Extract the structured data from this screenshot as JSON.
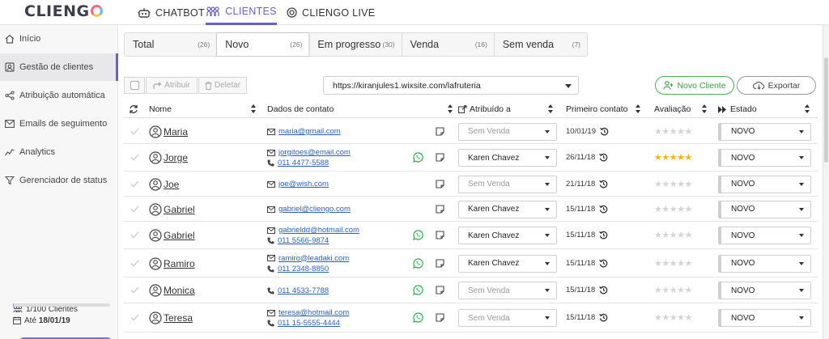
{
  "brand": {
    "logo_text": "CLIENG",
    "accent": "#6c5fc7"
  },
  "top_nav": [
    {
      "label": "CHATBOT",
      "icon": "robot-icon"
    },
    {
      "label": "CLIENTES",
      "icon": "people-icon",
      "active": true
    },
    {
      "label": "CLIENGO LIVE",
      "icon": "live-icon"
    }
  ],
  "sidebar": {
    "items": [
      {
        "label": "Início",
        "icon": "home-icon"
      },
      {
        "label": "Gestão de clientes",
        "icon": "person-card-icon",
        "active": true
      },
      {
        "label": "Atribuição automática",
        "icon": "share-icon"
      },
      {
        "label": "Emails de seguimento",
        "icon": "mail-icon"
      },
      {
        "label": "Analytics",
        "icon": "analytics-icon"
      },
      {
        "label": "Gerenciador de status",
        "icon": "funnel-icon"
      }
    ],
    "clients_usage": "1/100 Clientes",
    "until_label": "Até",
    "until_date": "18/01/19",
    "usage_fraction": 0.01
  },
  "status_tabs": [
    {
      "label": "Total",
      "count": "(26)"
    },
    {
      "label": "Novo",
      "count": "(26)",
      "active": true
    },
    {
      "label": "Em progresso",
      "count": "(30)"
    },
    {
      "label": "Venda",
      "count": "(16)"
    },
    {
      "label": "Sem venda",
      "count": "(7)"
    }
  ],
  "toolbar": {
    "assign_label": "Atribuir",
    "delete_label": "Deletar",
    "site_url": "https://kiranjules1.wixsite.com/lafruteria",
    "new_client_label": "Novo Cliente",
    "export_label": "Exportar"
  },
  "table": {
    "headers": {
      "name": "Nome",
      "contact": "Dados de contato",
      "assigned": "Atribuído a",
      "first_contact": "Primeiro contato",
      "rating": "Avaliação",
      "status": "Estado"
    },
    "rows": [
      {
        "name": "Maria",
        "email": "maria@gmail.com",
        "phone": "",
        "whatsapp": false,
        "assigned": "Sem Venda",
        "assigned_placeholder": true,
        "first_contact": "10/01/19",
        "rating": 0,
        "status": "NOVO"
      },
      {
        "name": "Jorge",
        "email": "jorgitoes@email.com",
        "phone": "011 4477-5588",
        "whatsapp": true,
        "assigned": "Karen Chavez",
        "assigned_placeholder": false,
        "first_contact": "26/11/18",
        "rating": 5,
        "status": "NOVO"
      },
      {
        "name": "Joe",
        "email": "joe@wish.com",
        "phone": "",
        "whatsapp": false,
        "assigned": "Sem Venda",
        "assigned_placeholder": true,
        "first_contact": "21/11/18",
        "rating": 0,
        "status": "NOVO"
      },
      {
        "name": "Gabriel",
        "email": "gabriel@cliengo.com",
        "phone": "",
        "whatsapp": false,
        "assigned": "Karen Chavez",
        "assigned_placeholder": false,
        "first_contact": "15/11/18",
        "rating": 0,
        "status": "NOVO"
      },
      {
        "name": "Gabriel",
        "email": "gabrieldd@hotmail.com",
        "phone": "011 5566-9874",
        "whatsapp": true,
        "assigned": "Karen Chavez",
        "assigned_placeholder": false,
        "first_contact": "15/11/18",
        "rating": 0,
        "status": "NOVO"
      },
      {
        "name": "Ramiro",
        "email": "ramiro@leadaki.com",
        "phone": "011 2348-8850",
        "whatsapp": true,
        "assigned": "Karen Chavez",
        "assigned_placeholder": false,
        "first_contact": "15/11/18",
        "rating": 0,
        "status": "NOVO"
      },
      {
        "name": "Monica",
        "email": "",
        "phone": "011 4533-7788",
        "whatsapp": true,
        "assigned": "Sem Venda",
        "assigned_placeholder": true,
        "first_contact": "15/11/18",
        "rating": 0,
        "status": "NOVO"
      },
      {
        "name": "Teresa",
        "email": "teresa@hotmail.com",
        "phone": "011 15-5555-4444",
        "whatsapp": true,
        "assigned": "Sem Venda",
        "assigned_placeholder": true,
        "first_contact": "15/11/18",
        "rating": 0,
        "status": "NOVO"
      }
    ]
  },
  "colors": {
    "whatsapp": "#25b34a",
    "star_on": "#f5b50a",
    "star_off": "#d4d4d4",
    "link": "#2a64c0",
    "green_button": "#3b9c46"
  }
}
